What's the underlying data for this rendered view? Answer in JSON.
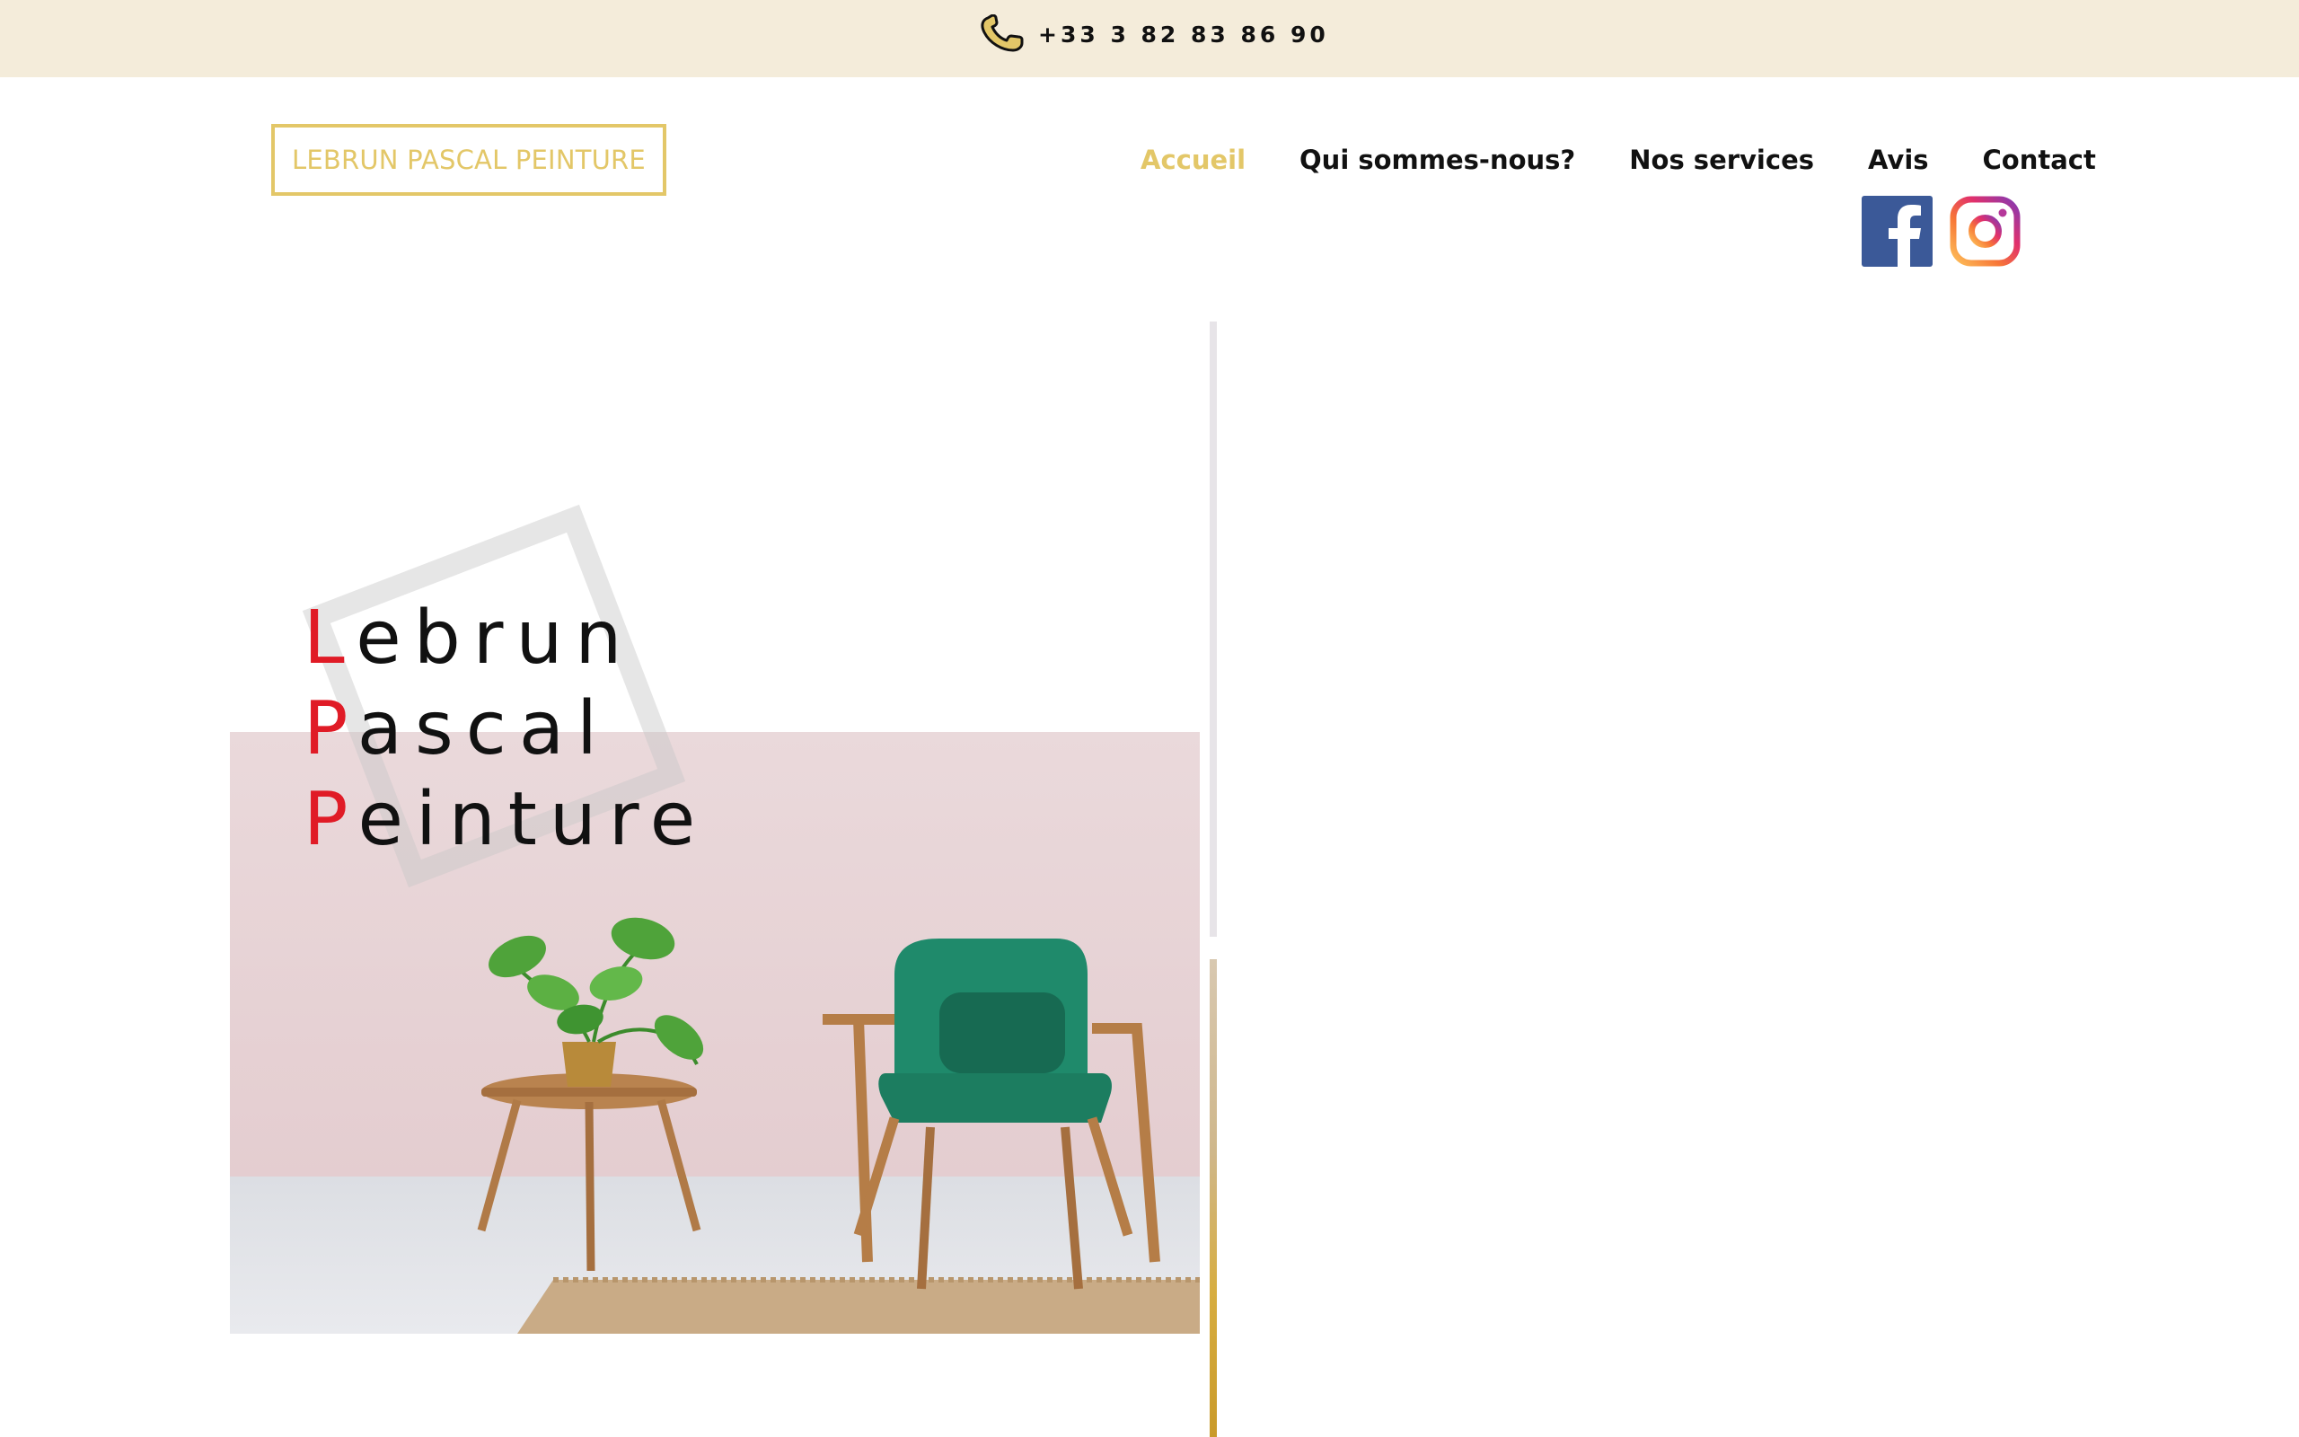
{
  "topbar": {
    "phone_icon": "phone-icon",
    "phone": "+33 3 82 83 86 90"
  },
  "header": {
    "logo": "LEBRUN PASCAL PEINTURE",
    "nav": [
      {
        "label": "Accueil",
        "active": true
      },
      {
        "label": "Qui sommes-nous?",
        "active": false
      },
      {
        "label": "Nos services",
        "active": false
      },
      {
        "label": "Avis",
        "active": false
      },
      {
        "label": "Contact",
        "active": false
      }
    ],
    "social": [
      "facebook-icon",
      "instagram-icon"
    ]
  },
  "hero": {
    "brand_lines": [
      {
        "cap": "L",
        "rest": "ebrun"
      },
      {
        "cap": "P",
        "rest": "ascal"
      },
      {
        "cap": "P",
        "rest": "einture"
      }
    ]
  },
  "colors": {
    "topbar_bg": "#f4ecda",
    "accent_gold": "#e3c768",
    "brand_red": "#e01b26",
    "wall_pink": "#e8d5d8"
  }
}
